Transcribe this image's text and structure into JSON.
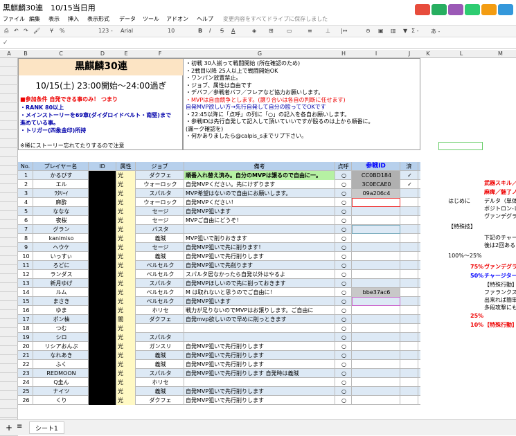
{
  "title": "黒麒麟30連　10/15当日用",
  "menu": [
    "ファイル",
    "編集",
    "表示",
    "挿入",
    "表示形式",
    "データ",
    "ツール",
    "アドオン",
    "ヘルプ",
    "変更内容をすべてドライブに保存しました"
  ],
  "toolbar": {
    "zoom": "¥",
    "percent": "%",
    ".0": ".0_",
    ".00": ".00",
    "format123": "123 -",
    "font": "Arial",
    "size": "10",
    "bold": "B",
    "italic": "I",
    "strike": "S",
    "textcolor": "A",
    "ime": "あ -",
    "sum": "Σ -"
  },
  "columns": [
    "A",
    "B",
    "C",
    "D",
    "E",
    "F",
    "G",
    "H",
    "I",
    "J",
    "K",
    "L",
    "M"
  ],
  "info": {
    "title": "黒麒麟30連",
    "datetime": "10/15(土) 23:00開始～24:00過ぎ",
    "cond1": "■参加条件  自発できる事のみ！  つまり",
    "cond2": "・RANK 80以上",
    "cond3": "・メインストーリーを69章(ダイダロイドベルト・南堅)まで",
    "cond4": "  進めている事。",
    "cond5": "・トリガー(四象金印)所持",
    "note": "※稀にストーリー忘れてたりするので注意",
    "rules": [
      "・初戦  30人揃って戦闘開始 (所在確認のため)",
      "・2戦目以降  25人以上で戦闘開始OK",
      "",
      "・ワンパン放置禁止。",
      "・ジョブ、属性は自由です",
      "・デバフ／参戦者バフ／フレアなど協力お願いします。",
      "・MVPは自由競争とします。(譲り合いは各自の判断に任せます)",
      "  自発MVP欲しい方→先行自発して自分の殴ってでOKです",
      "・22:45以降に「点呼」の列に「○」の記入を各自お願いします。",
      "・参戦IDは先行自発して記入して頂いていいですが殴るのは上から順番に。",
      "  (漏ーク確認を)",
      "・何かありましたら@calpis_sまでリプ下さい。"
    ]
  },
  "headers": {
    "no": "No.",
    "name": "プレイヤー名",
    "id": "ID",
    "attr": "属性",
    "job": "ジョブ",
    "note": "備考",
    "roll": "点呼",
    "battle": "参戦ID",
    "done": "済"
  },
  "rows": [
    {
      "no": "1",
      "name": "かるびす",
      "attr": "光",
      "job": "ダクフェ",
      "note": "順番入れ替え済み。自分のMVPは譲るので自由に一。",
      "bid": "CC0BD184",
      "done": "✓"
    },
    {
      "no": "2",
      "name": "エル",
      "attr": "光",
      "job": "ウォーロック",
      "note": "自発MVPください。先にけずります",
      "bid": "3C0ECAE0",
      "done": "✓"
    },
    {
      "no": "3",
      "name": "ﾜﾀﾘｰｲ",
      "attr": "光",
      "job": "スパルタ",
      "note": "MVP希望はないので自由にお願いします。",
      "bid": "09a206c4",
      "done": ""
    },
    {
      "no": "4",
      "name": "麻酔",
      "attr": "光",
      "job": "ウォーロック",
      "note": "自発MVPください！",
      "bid": "",
      "done": ""
    },
    {
      "no": "5",
      "name": "ななな",
      "attr": "光",
      "job": "セージ",
      "note": "自発MVP狙います",
      "bid": "",
      "done": ""
    },
    {
      "no": "6",
      "name": "夜桜",
      "attr": "光",
      "job": "セージ",
      "note": "MVPご自由にどうぞ！",
      "bid": "",
      "done": ""
    },
    {
      "no": "7",
      "name": "グラン",
      "attr": "光",
      "job": "バスタ",
      "note": "",
      "bid": "",
      "done": ""
    },
    {
      "no": "8",
      "name": "kanimiso",
      "attr": "光",
      "job": "義賊",
      "note": "MVP狙いで削りおきます",
      "bid": "",
      "done": ""
    },
    {
      "no": "9",
      "name": "ヘウケ",
      "attr": "光",
      "job": "セージ",
      "note": "自発MVP狙いで先に削ります！",
      "bid": "",
      "done": ""
    },
    {
      "no": "10",
      "name": "いっすぃ",
      "attr": "光",
      "job": "義賊",
      "note": "自発MVP狙いで先行削りします",
      "bid": "",
      "done": ""
    },
    {
      "no": "11",
      "name": "ろどに",
      "attr": "光",
      "job": "ベルセルク",
      "note": "自発MVP狙いで先削ります",
      "bid": "",
      "done": ""
    },
    {
      "no": "12",
      "name": "ランダス",
      "attr": "光",
      "job": "ベルセルク",
      "note": "スパルタ居なかったら自発以外はやるよ",
      "bid": "",
      "done": ""
    },
    {
      "no": "13",
      "name": "新月ゆげ",
      "attr": "光",
      "job": "スパルタ",
      "note": "自発MVPほしいので先に削っておきます",
      "bid": "",
      "done": ""
    },
    {
      "no": "14",
      "name": "ルム",
      "attr": "光",
      "job": "ベルセルク",
      "note": "M は取れないと思うのでご自由に！",
      "bid": "bbe37ac6",
      "done": ""
    },
    {
      "no": "15",
      "name": "まさき",
      "attr": "光",
      "job": "ベルセルク",
      "note": "自発MVP狙います",
      "bid": "",
      "done": ""
    },
    {
      "no": "16",
      "name": "ゆま",
      "attr": "光",
      "job": "ホリセ",
      "note": "戦力が足りないのでMVPはお譲りします。ご自由に",
      "bid": "",
      "done": ""
    },
    {
      "no": "17",
      "name": "ポン柚",
      "attr": "闇",
      "job": "ダクフェ",
      "note": "自発mvp欲しいので早めに削っときます",
      "bid": "",
      "done": ""
    },
    {
      "no": "18",
      "name": "つむ",
      "attr": "光",
      "job": "",
      "note": "",
      "bid": "",
      "done": ""
    },
    {
      "no": "19",
      "name": "シロ",
      "attr": "光",
      "job": "スパルタ",
      "note": "",
      "bid": "",
      "done": ""
    },
    {
      "no": "20",
      "name": "リシアおんぷ",
      "attr": "光",
      "job": "ガンスリ",
      "note": "自発MVP狙いで先行削りします",
      "bid": "",
      "done": ""
    },
    {
      "no": "21",
      "name": "なれあき",
      "attr": "光",
      "job": "義賊",
      "note": "自発MVP狙いで先行削りします",
      "bid": "",
      "done": ""
    },
    {
      "no": "22",
      "name": "ふく",
      "attr": "光",
      "job": "義賊",
      "note": "自発MVP狙いで先行削りします",
      "bid": "",
      "done": ""
    },
    {
      "no": "23",
      "name": "REDMOON",
      "attr": "光",
      "job": "スパルタ",
      "note": "自発MVP狙いで先行削りします 自発時は義賊",
      "bid": "",
      "done": ""
    },
    {
      "no": "24",
      "name": "Q圭ん",
      "attr": "光",
      "job": "ホリセ",
      "note": "",
      "bid": "",
      "done": ""
    },
    {
      "no": "25",
      "name": "ナイツ",
      "attr": "光",
      "job": "義賊",
      "note": "自発MVP狙いで先行削りします",
      "bid": "",
      "done": ""
    },
    {
      "no": "26",
      "name": "くり",
      "attr": "光",
      "job": "ダクフェ",
      "note": "自発MVP狙いで先行削りします",
      "bid": "",
      "done": ""
    }
  ],
  "side": {
    "l1": "武器スキル／",
    "l2": "麻痺／魅了ノ",
    "hajime": "はじめに",
    "t1": "デルタ（単体",
    "t2": "ボジトロン-レ",
    "t3": "ヴァンデグラ",
    "tokushu": "【特殊技】",
    "t4": "下記のチャー",
    "t5": "後は2回ある",
    "pct1": "100%～25%",
    "pct2": "75%",
    "v2": "ヴァンデグラ",
    "pct3": "50%",
    "v3": "チャージター",
    "t6": "【特殊行動】ス",
    "t7": "ファランクス＋",
    "t8": "出来れば簡単",
    "t9": "多段攻撃にも",
    "pct4": "25%",
    "pct5": "10%",
    "v5": "【特殊行動】ス"
  },
  "sheet_tab": "シート1"
}
